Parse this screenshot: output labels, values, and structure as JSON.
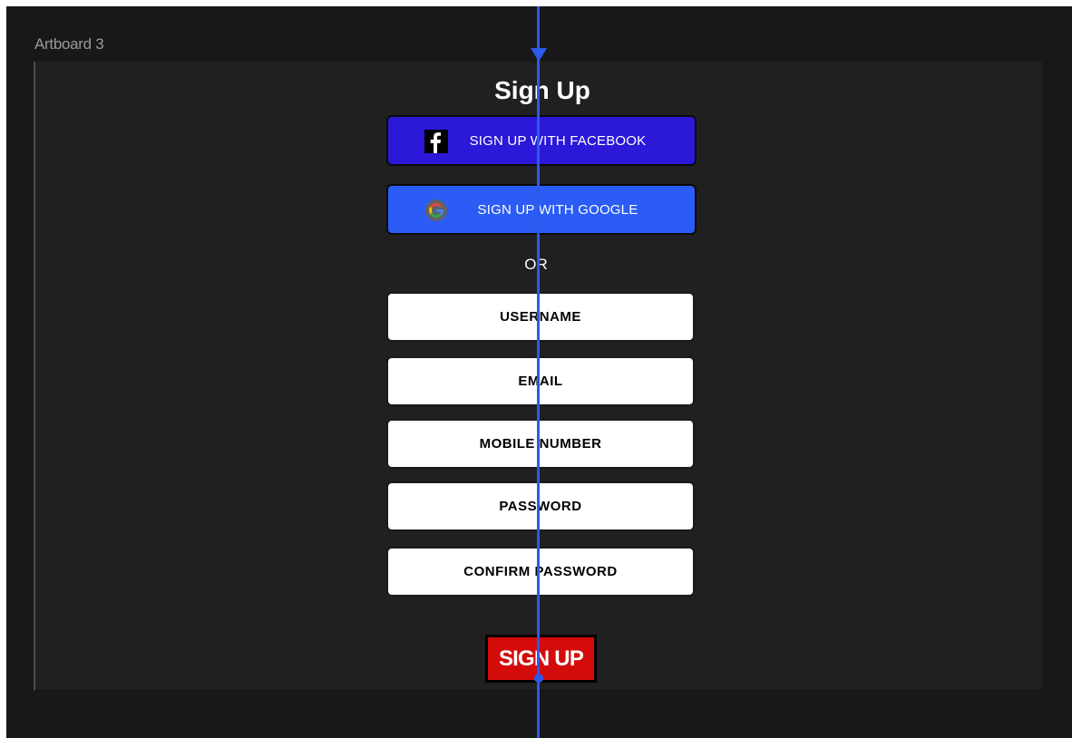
{
  "artboard": {
    "label": "Artboard 3"
  },
  "form": {
    "title": "Sign Up",
    "facebook_button": "SIGN UP WITH FACEBOOK",
    "google_button": "SIGN UP WITH GOOGLE",
    "separator": "OR",
    "fields": {
      "username": "USERNAME",
      "email": "EMAIL",
      "mobile": "MOBILE NUMBER",
      "password": "PASSWORD",
      "confirm_password": "CONFIRM PASSWORD"
    },
    "submit_button": "SIGN UP"
  },
  "icons": {
    "facebook": "facebook-icon",
    "google": "google-icon"
  },
  "colors": {
    "facebook_button": "#2b18d8",
    "google_button": "#2b5cf5",
    "submit_button": "#d40b0b",
    "guide_line": "#2a5bea",
    "canvas": "#181818",
    "artboard": "#202020"
  }
}
